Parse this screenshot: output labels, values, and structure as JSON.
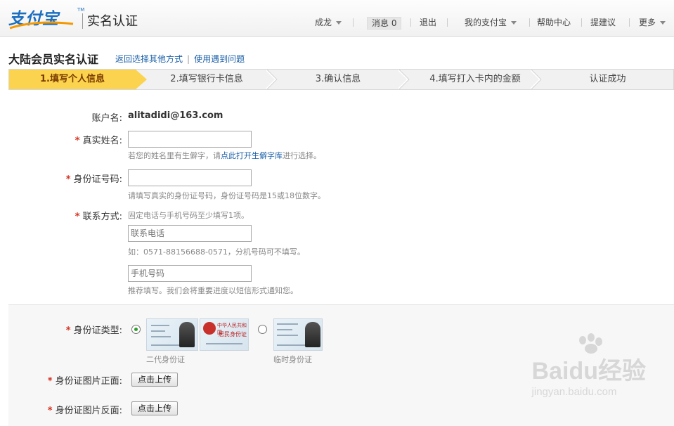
{
  "header": {
    "logo_text": "支付宝",
    "logo_tm": "TM",
    "title": "实名认证",
    "nav": {
      "user": "成龙",
      "messages_label": "消息",
      "messages_count": "0",
      "logout": "退出",
      "my_alipay": "我的支付宝",
      "help": "帮助中心",
      "suggest": "提建议",
      "more": "更多"
    }
  },
  "page": {
    "title": "大陆会员实名认证",
    "link_other": "返回选择其他方式",
    "link_problem": "使用遇到问题"
  },
  "steps": [
    {
      "label": "1.填写个人信息",
      "active": true
    },
    {
      "label": "2.填写银行卡信息",
      "active": false
    },
    {
      "label": "3.确认信息",
      "active": false
    },
    {
      "label": "4.填写打入卡内的金额",
      "active": false
    },
    {
      "label": "认证成功",
      "active": false
    }
  ],
  "form": {
    "account_label": "账户名:",
    "account_value": "alitadidi@163.com",
    "realname_label": "真实姓名:",
    "realname_value": "",
    "realname_hint_prefix": "若您的姓名里有生僻字，请",
    "realname_hint_link": "点此打开生僻字库",
    "realname_hint_suffix": "进行选择。",
    "idnum_label": "身份证号码:",
    "idnum_value": "",
    "idnum_hint": "请填写真实的身份证号码，身份证号码是15或18位数字。",
    "contact_label": "联系方式:",
    "contact_hint": "固定电话与手机号码至少填写1项。",
    "phone_placeholder": "联系电话",
    "phone_hint": "如：0571-88156688-0571，分机号码可不填写。",
    "mobile_placeholder": "手机号码",
    "mobile_hint": "推荐填写。我们会将重要进度以短信形式通知您。",
    "idtype_label": "身份证类型:",
    "idtype_options": [
      {
        "label": "二代身份证",
        "checked": true
      },
      {
        "label": "临时身份证",
        "checked": false
      }
    ],
    "card_text": {
      "country": "中华人民共和国",
      "card_name": "居民身份证"
    },
    "front_label": "身份证图片正面:",
    "back_label": "身份证图片反面:",
    "upload_label": "点击上传"
  },
  "watermark": {
    "main": "Baidu经验",
    "sub": "jingyan.baidu.com"
  },
  "colors": {
    "accent_blue": "#1a5fa8",
    "step_active": "#fbd34e",
    "required_star": "#d7301f"
  }
}
